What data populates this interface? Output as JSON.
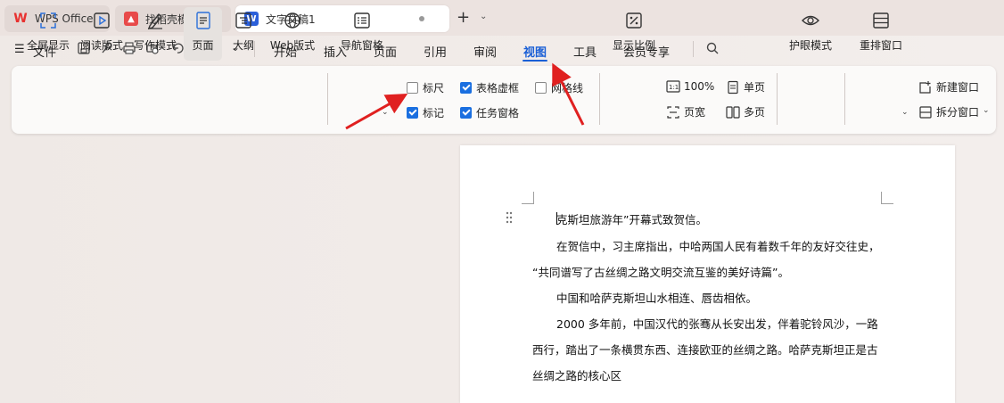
{
  "tabs": [
    {
      "label": "WPS Office",
      "logo": "wps-logo-icon",
      "color": "#e8312f"
    },
    {
      "label": "找稻壳模板",
      "logo": "docer-logo-icon",
      "color": "#e84a4a"
    },
    {
      "label": "文字文稿1",
      "logo": "writer-logo-icon",
      "color": "#2b5fd9"
    }
  ],
  "menu": {
    "file": "文件",
    "items": [
      "开始",
      "插入",
      "页面",
      "引用",
      "审阅",
      "视图",
      "工具",
      "会员专享"
    ],
    "active": "视图"
  },
  "ribbon": {
    "view_buttons": [
      "全屏显示",
      "阅读版式",
      "写作模式",
      "页面",
      "大纲",
      "Web版式"
    ],
    "nav_pane": "导航窗格",
    "checkboxes": [
      {
        "label": "标尺",
        "checked": false
      },
      {
        "label": "表格虚框",
        "checked": true
      },
      {
        "label": "网格线",
        "checked": false
      },
      {
        "label": "标记",
        "checked": true
      },
      {
        "label": "任务窗格",
        "checked": true
      }
    ],
    "zoom_ratio": "显示比例",
    "zoom_100": "100%",
    "page_width": "页宽",
    "single_page": "单页",
    "multi_page": "多页",
    "eye_mode": "护眼模式",
    "rearrange": "重排窗口",
    "new_window": "新建窗口",
    "split_window": "拆分窗口"
  },
  "document": {
    "lines": [
      "克斯坦旅游年”开幕式致贺信。",
      "在贺信中，习主席指出，中哈两国人民有着数千年的友好交往史，",
      "“共同谱写了古丝绸之路文明交流互鉴的美好诗篇”。",
      "中国和哈萨克斯坦山水相连、唇齿相依。",
      "2000 多年前，中国汉代的张骞从长安出发，伴着驼铃风沙，一路",
      "西行，踏出了一条横贯东西、连接欧亚的丝绸之路。哈萨克斯坦正是古",
      "丝绸之路的核心区"
    ]
  },
  "colors": {
    "accent": "#1a5fd6",
    "annotation": "#e02020"
  }
}
